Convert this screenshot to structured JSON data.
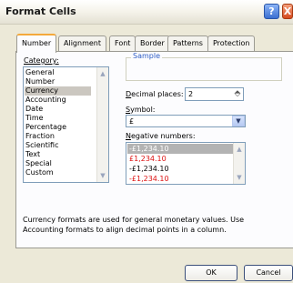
{
  "title": "Format Cells",
  "title_buttons": {
    "help": "?",
    "close": "X"
  },
  "tabs": [
    "Number",
    "Alignment",
    "Font",
    "Border",
    "Patterns",
    "Protection"
  ],
  "active_tab": "Number",
  "category": {
    "label": "Category:",
    "items": [
      "General",
      "Number",
      "Currency",
      "Accounting",
      "Date",
      "Time",
      "Percentage",
      "Fraction",
      "Scientific",
      "Text",
      "Special",
      "Custom"
    ],
    "selected": "Currency"
  },
  "sample": {
    "label": "Sample",
    "value": ""
  },
  "decimal_places": {
    "label": "Decimal places:",
    "value": "2"
  },
  "symbol": {
    "label": "Symbol:",
    "value": "£"
  },
  "negative_numbers": {
    "label": "Negative numbers:",
    "items": [
      {
        "text": "-£1,234.10",
        "color": "#ffffff",
        "selected": true
      },
      {
        "text": "£1,234.10",
        "color": "#dd1111",
        "selected": false
      },
      {
        "text": "-£1,234.10",
        "color": "#000000",
        "selected": false
      },
      {
        "text": "-£1,234.10",
        "color": "#dd1111",
        "selected": false
      }
    ]
  },
  "description": "Currency formats are used for general monetary values.  Use Accounting formats to align decimal points in a column.",
  "buttons": {
    "ok": "OK",
    "cancel": "Cancel"
  }
}
